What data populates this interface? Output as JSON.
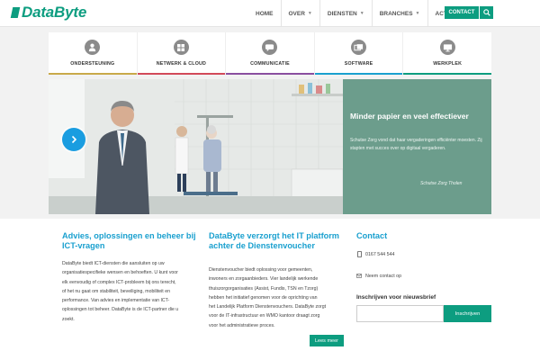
{
  "brand": {
    "name": "DataByte",
    "color": "#0d9d80",
    "link_color": "#1aa0cf"
  },
  "nav": {
    "items": [
      {
        "label": "HOME",
        "dropdown": false
      },
      {
        "label": "OVER",
        "dropdown": true
      },
      {
        "label": "DIENSTEN",
        "dropdown": true
      },
      {
        "label": "BRANCHES",
        "dropdown": true
      },
      {
        "label": "ACTUEEL",
        "dropdown": true
      }
    ],
    "contact_label": "CONTACT",
    "search_icon": "search-icon"
  },
  "tiles": [
    {
      "label": "ONDERSTEUNING",
      "icon": "person-icon",
      "bar_color": "#c9a94a"
    },
    {
      "label": "NETWERK & CLOUD",
      "icon": "network-grid-icon",
      "bar_color": "#d24a5a"
    },
    {
      "label": "COMMUNICATIE",
      "icon": "chat-icon",
      "bar_color": "#8a4fa0"
    },
    {
      "label": "SOFTWARE",
      "icon": "windows-icon",
      "bar_color": "#1aa0cf"
    },
    {
      "label": "WERKPLEK",
      "icon": "monitor-icon",
      "bar_color": "#0d9d80"
    }
  ],
  "hero": {
    "title": "Minder papier en veel effectiever",
    "text": "Schutse Zorg vond dat haar vergaderingen efficiënter moesten. Zij stapten met succes over op digitaal vergaderen.",
    "caption": "Schutse Zorg Tholen",
    "panel_color": "#6c9d8c",
    "arrow_icon": "chevron-right-icon"
  },
  "col1": {
    "title": "Advies, oplossingen en beheer bij ICT-vragen",
    "lines": [
      "DataByte biedt ICT-diensten die aansluiten op uw",
      "organisatiespecifieke wensen en behoeften. U kunt voor",
      "elk eenvoudig of complex ICT-probleem bij ons terecht,",
      "of het nu gaat om stabiliteit, beveiliging, mobiliteit en",
      "performance. Van advies en implementatie van ICT-",
      "oplossingen tot beheer. DataByte is de ICT-partner die u",
      "zoekt."
    ]
  },
  "col2": {
    "title": "DataByte verzorgt het IT platform achter de Dienstenvoucher",
    "lines": [
      "Dienstenvoucher biedt oplossing voor gemeenten,",
      "inwoners en zorgaanbieders. Vier landelijk werkende",
      "thuiszorgorganisaties (Assist, Fundis, TSN en Tzorg)",
      "hebben het initiatief genomen voor de oprichting van",
      "het Landelijk Platform Dienstenvouchers. DataByte zorgt",
      "voor de IT-infrastructuur en WMO kantoor draagt zorg",
      "voor het administratieve proces."
    ],
    "read_more": "Lees meer"
  },
  "contact": {
    "title": "Contact",
    "phone": "0167 544 544",
    "email_link": "Neem contact op",
    "newsletter_title": "Inschrijven voor nieuwsbrief",
    "newsletter_placeholder": "",
    "newsletter_button": "Inschrijven"
  }
}
